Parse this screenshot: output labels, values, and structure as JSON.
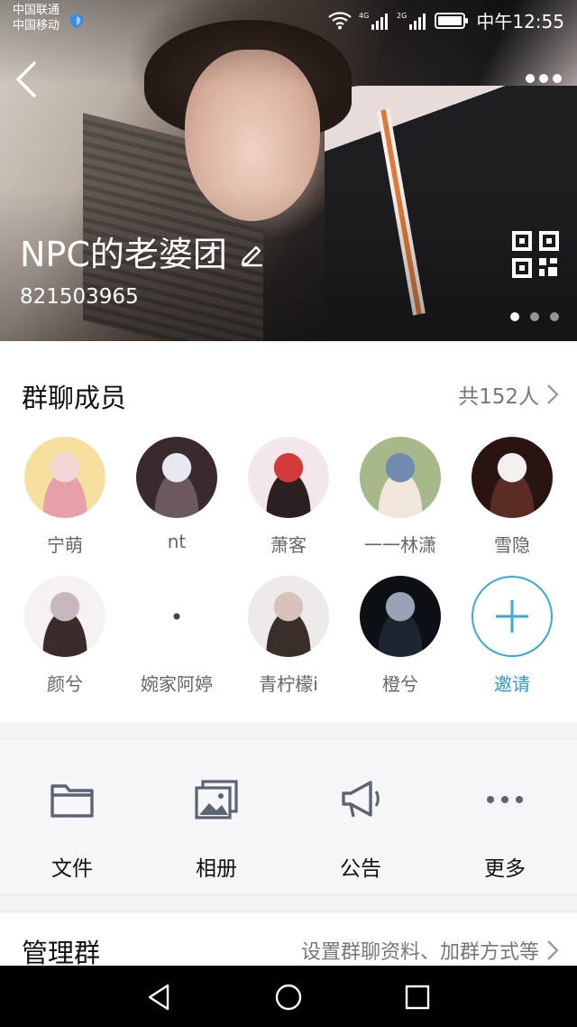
{
  "status_bar": {
    "carrier_1": "中国联通",
    "carrier_2": "中国移动",
    "net_1": "4G",
    "net_2": "2G",
    "time": "中午12:55"
  },
  "header": {
    "group_name": "NPC的老婆团",
    "group_id": "821503965",
    "slide_count": 3,
    "active_slide": 1
  },
  "members": {
    "title": "群聊成员",
    "count_text": "共152人",
    "list": [
      {
        "name": "宁萌",
        "colors": [
          "#f5e0a0",
          "#e8a0a8",
          "#f3d7d7"
        ]
      },
      {
        "name": "nt",
        "colors": [
          "#3a2a2e",
          "#6c5860",
          "#e8e8f0"
        ]
      },
      {
        "name": "萧客",
        "colors": [
          "#f4e8ec",
          "#2b1f1f",
          "#d43a3a"
        ]
      },
      {
        "name": "一一林潇",
        "colors": [
          "#a7b98a",
          "#f0e6dc",
          "#6f8cb0"
        ]
      },
      {
        "name": "雪隐",
        "colors": [
          "#2a1412",
          "#5a2c24",
          "#f3f0ee"
        ]
      },
      {
        "name": "颜兮",
        "colors": [
          "#f6f2f4",
          "#3a2c2a",
          "#c8b6c0"
        ]
      },
      {
        "name": "婉家阿婷",
        "colors": [
          "#ffffff",
          "#ffffff",
          "#666666"
        ]
      },
      {
        "name": "青柠檬i",
        "colors": [
          "#eeeaea",
          "#3a2e2a",
          "#d9c2bc"
        ]
      },
      {
        "name": "橙兮",
        "colors": [
          "#0c0f14",
          "#1e2430",
          "#9aa3b5"
        ]
      }
    ],
    "invite_label": "邀请"
  },
  "actions": [
    {
      "label": "文件",
      "icon": "folder-icon"
    },
    {
      "label": "相册",
      "icon": "album-icon"
    },
    {
      "label": "公告",
      "icon": "announcement-icon"
    },
    {
      "label": "更多",
      "icon": "more-icon"
    }
  ],
  "admin": {
    "title": "管理群",
    "desc": "设置群聊资料、加群方式等"
  },
  "colors": {
    "accent": "#2e9ad0",
    "icon_gray": "#5c6372",
    "nav_bg": "#000000"
  }
}
